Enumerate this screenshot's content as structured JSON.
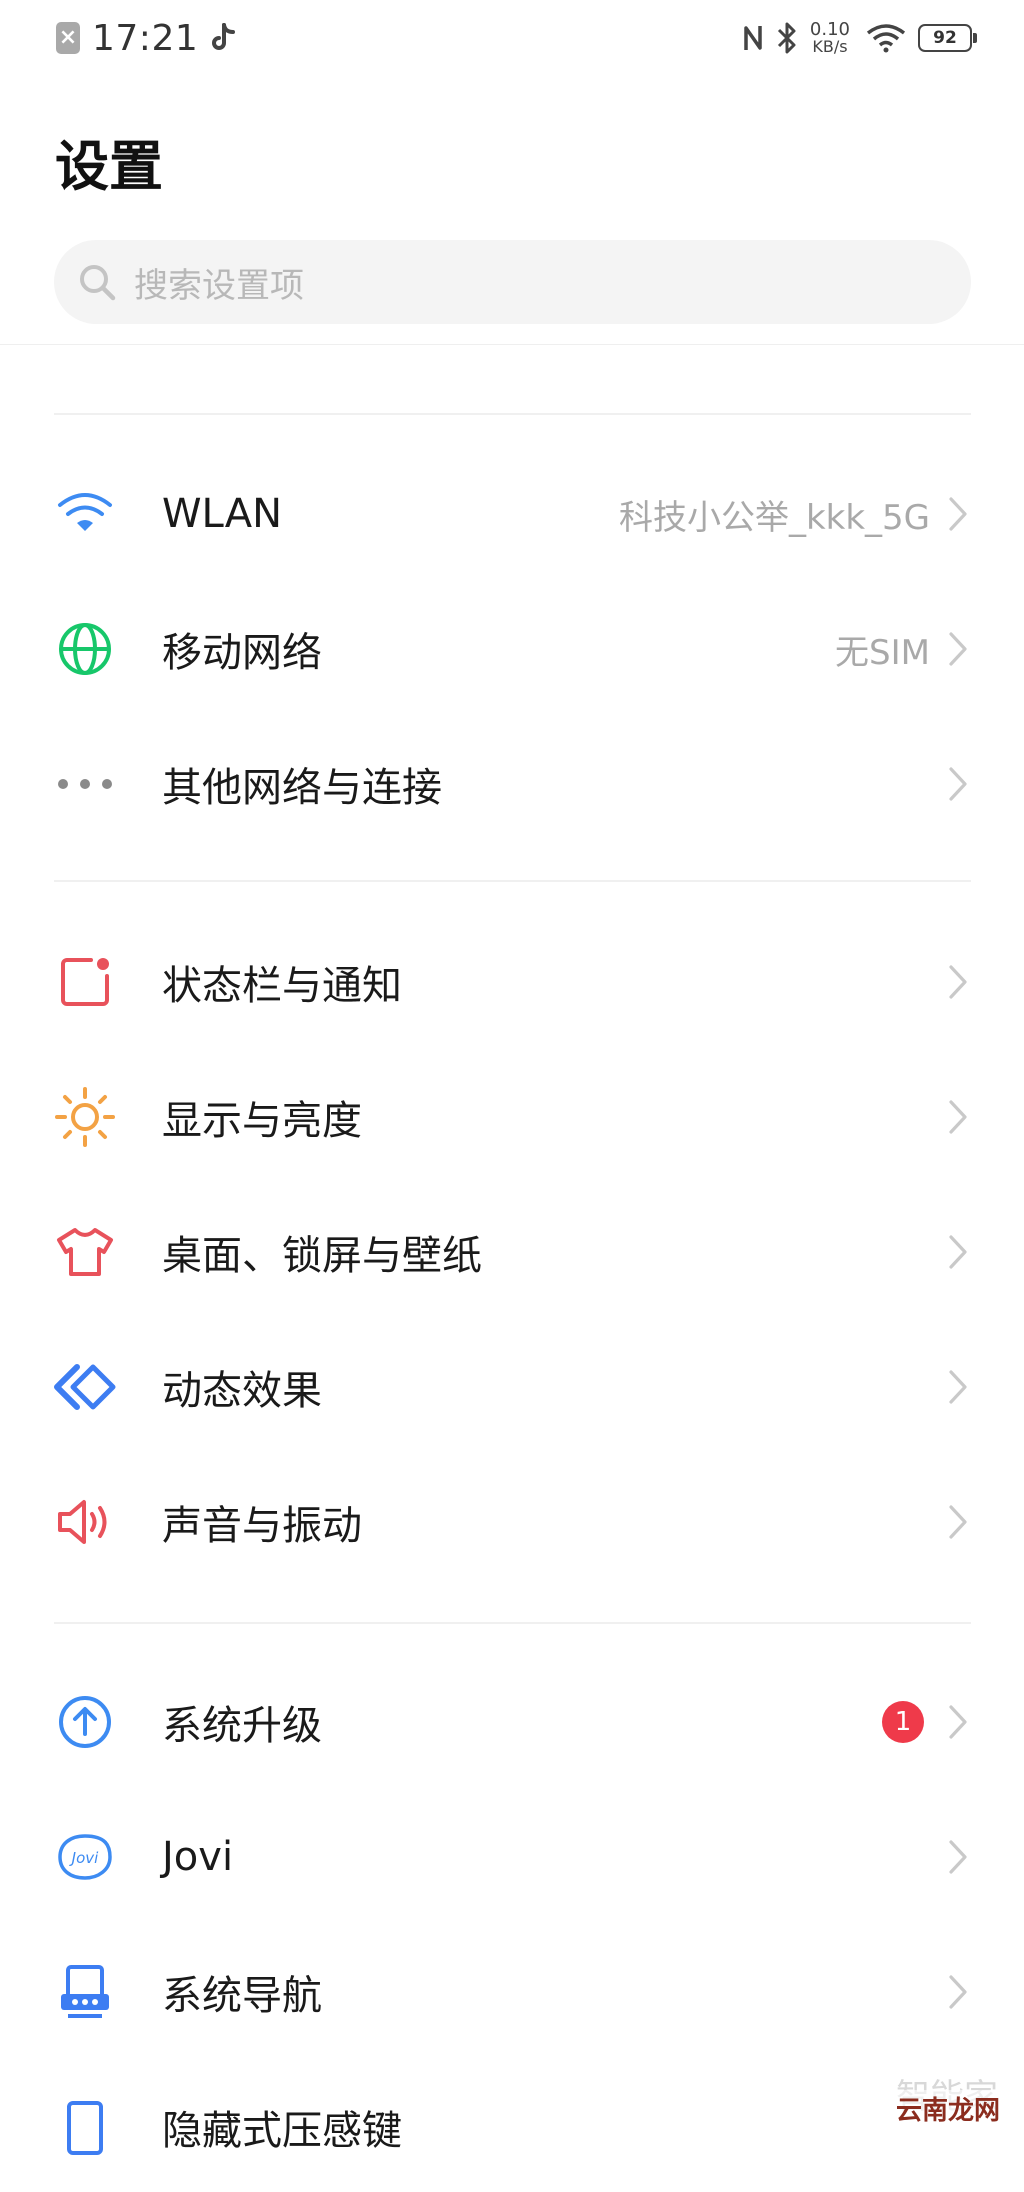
{
  "status_bar": {
    "time": "17:21",
    "net_speed_value": "0.10",
    "net_speed_unit": "KB/s",
    "battery": "92",
    "sim_icon": "sim-disabled-icon",
    "app_icon": "tiktok-icon"
  },
  "page": {
    "title": "设置"
  },
  "search": {
    "placeholder": "搜索设置项"
  },
  "groups": [
    {
      "items": [
        {
          "label": "WLAN",
          "value": "科技小公举_kkk_5G",
          "icon": "wifi-icon",
          "color": "#3d8bf2"
        },
        {
          "label": "移动网络",
          "value": "无SIM",
          "icon": "globe-icon",
          "color": "#17c76a"
        },
        {
          "label": "其他网络与连接",
          "icon": "more-dots-icon",
          "color": "#8a8a8a"
        }
      ]
    },
    {
      "items": [
        {
          "label": "状态栏与通知",
          "icon": "notification-icon",
          "color": "#e8525b"
        },
        {
          "label": "显示与亮度",
          "icon": "sun-icon",
          "color": "#f3a244"
        },
        {
          "label": "桌面、锁屏与壁纸",
          "icon": "tshirt-icon",
          "color": "#e8525b"
        },
        {
          "label": "动态效果",
          "icon": "dynamic-effect-icon",
          "color": "#3d7df2"
        },
        {
          "label": "声音与振动",
          "icon": "speaker-icon",
          "color": "#e8525b"
        }
      ]
    },
    {
      "items": [
        {
          "label": "系统升级",
          "badge": "1",
          "icon": "upgrade-arrow-icon",
          "color": "#3d8bf2"
        },
        {
          "label": "Jovi",
          "icon": "jovi-icon",
          "color": "#3d8bf2"
        },
        {
          "label": "系统导航",
          "icon": "navigation-icon",
          "color": "#3d7df2"
        },
        {
          "label": "隐藏式压感键",
          "icon": "phone-icon",
          "color": "#3d7df2"
        }
      ]
    }
  ],
  "watermark": {
    "text1": "智能家",
    "text2": "云南龙网"
  }
}
